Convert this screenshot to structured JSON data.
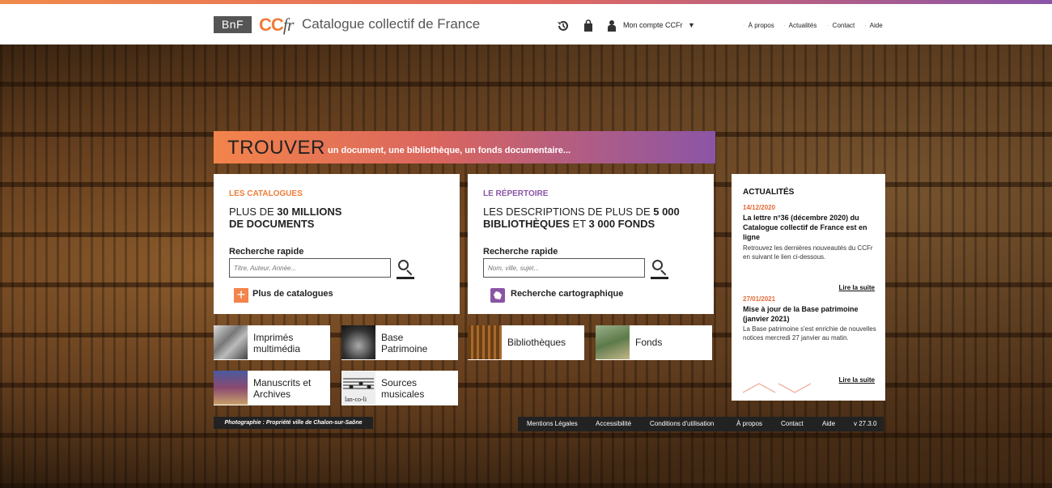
{
  "header": {
    "bnf_logo": "BnF",
    "ccfr_logo_a": "CC",
    "ccfr_logo_b": "fr",
    "site_title": "Catalogue collectif de France",
    "account_label": "Mon compte CCFr",
    "nav": [
      "À propos",
      "Actualités",
      "Contact",
      "Aide"
    ]
  },
  "banner": {
    "title": "TROUVER",
    "subtitle": "un document, une bibliothèque, un fonds documentaire..."
  },
  "catalogues": {
    "label": "LES CATALOGUES",
    "head_a": "PLUS DE ",
    "head_b": "30 MILLIONS",
    "head_c": "DE DOCUMENTS",
    "quick_search_label": "Recherche rapide",
    "placeholder": "Titre, Auteur, Année...",
    "more_label": "Plus de catalogues",
    "label_color": "#f07c3a"
  },
  "repertoire": {
    "label": "LE RÉPERTOIRE",
    "head_a": "LES DESCRIPTIONS DE PLUS DE ",
    "head_b": "5 000",
    "head_c": "BIBLIOTHÈQUES",
    "head_d": " ET ",
    "head_e": "3 000 FONDS",
    "quick_search_label": "Recherche rapide",
    "placeholder": "Nom, ville, sujet...",
    "map_label": "Recherche cartographique",
    "label_color": "#8b55a6"
  },
  "tiles": {
    "imprimes": "Imprimés multimédia",
    "base": "Base Patrimoine",
    "bibliotheques": "Bibliothèques",
    "fonds": "Fonds",
    "manuscrits": "Manuscrits et Archives",
    "sources": "Sources musicales"
  },
  "news": {
    "title": "ACTUALITÉS",
    "items": [
      {
        "date": "14/12/2020",
        "headline": "La lettre n°36 (décembre 2020) du Catalogue collectif de France est en ligne",
        "text": "Retrouvez les dernières nouveautés du CCFr en suivant le lien ci-dessous.",
        "more": "Lire la suite"
      },
      {
        "date": "27/01/2021",
        "headline": "Mise à jour de la Base patrimoine (janvier 2021)",
        "text": "La Base patrimoine s'est enrichie de nouvelles notices mercredi 27 janvier au matin.",
        "more": "Lire la suite"
      }
    ]
  },
  "photo_credit": "Photographie : Propriété ville de Chalon-sur-Saône",
  "footer": [
    "Mentions Légales",
    "Accessibilité",
    "Conditions d'utilisation",
    "À propos",
    "Contact",
    "Aide",
    "v 27.3.0"
  ]
}
